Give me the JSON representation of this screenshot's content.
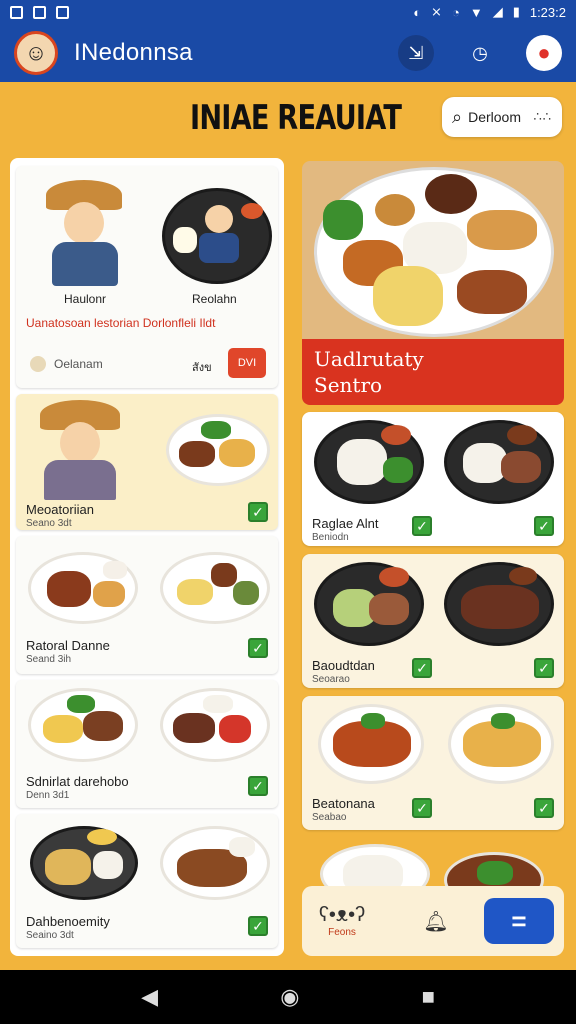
{
  "status_bar": {
    "time": "1:23:2",
    "icons": [
      "sim-icon",
      "notification-icon",
      "bag-icon",
      "nfc-icon",
      "vibrate-icon",
      "sync-icon",
      "wifi-icon",
      "signal-icon",
      "battery-icon"
    ]
  },
  "app": {
    "name": "INedonnsa",
    "logo": "logo-icon"
  },
  "header_actions": [
    "collapse-icon",
    "clock-icon",
    "record-icon"
  ],
  "headline": "INIAE REAUIAT",
  "search": {
    "text": "Derloom",
    "more": "∴∴"
  },
  "left": {
    "card1": {
      "caption_left": "Haulonr",
      "caption_right": "Reolahn",
      "red_title": "Uanatosoan lestorian Dorlonfleli Ildt",
      "meta": "Oelanam",
      "tag": "สังข",
      "button": "DVI"
    },
    "card2": {
      "title": "Meoatoriian",
      "sub": "Seano 3dt"
    },
    "card3": {
      "title": "Ratoral Danne",
      "sub": "Seand 3ih"
    },
    "card4": {
      "title": "Sdnirlat darehobo",
      "sub": "Denn 3d1"
    },
    "card5": {
      "title": "Dahbenoemity",
      "sub": "Seaino 3dt"
    }
  },
  "right": {
    "hero": {
      "line1": "Uadlrutaty",
      "line2": "Sentro"
    },
    "card1": {
      "title": "Raglae Alnt",
      "sub": "Beniodn"
    },
    "card2": {
      "title": "Baoudtdan",
      "sub": "Seoarao"
    },
    "card3": {
      "title": "Beatonana",
      "sub": "Seabao"
    }
  },
  "bottom_bar": {
    "item1_label": "Feons",
    "item1_icon": "bear-icon",
    "item2_icon": "bell-icon",
    "action": "="
  },
  "colors": {
    "primary": "#1a4aa6",
    "background": "#f2b43c",
    "accent_red": "#d9331f",
    "check_green": "#3aa53a",
    "button_blue": "#1f56c6"
  }
}
